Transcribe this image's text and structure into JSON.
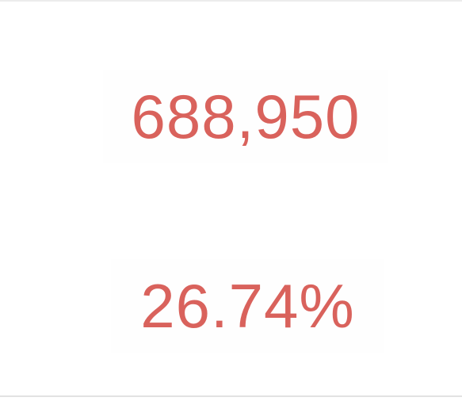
{
  "stats": {
    "primary_value": "688,950",
    "secondary_value": "26.74%"
  },
  "colors": {
    "value_text": "#d9625c",
    "divider": "#e2e2e2"
  }
}
